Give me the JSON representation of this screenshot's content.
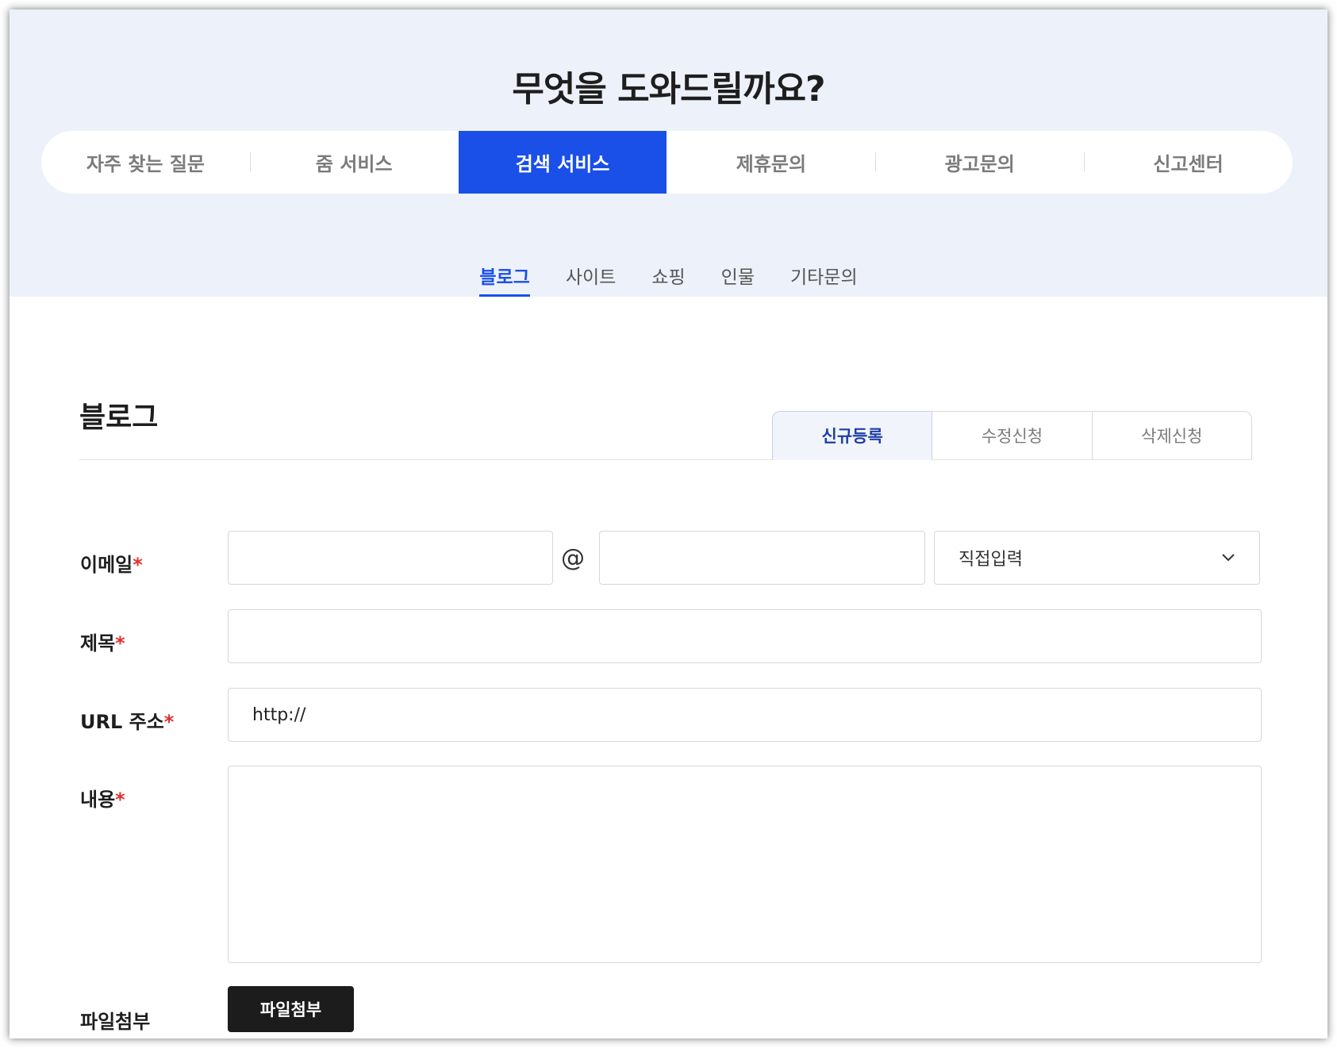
{
  "hero": {
    "title": "무엇을 도와드릴까요?"
  },
  "main_tabs": [
    {
      "label": "자주 찾는 질문",
      "active": false
    },
    {
      "label": "줌 서비스",
      "active": false
    },
    {
      "label": "검색 서비스",
      "active": true
    },
    {
      "label": "제휴문의",
      "active": false
    },
    {
      "label": "광고문의",
      "active": false
    },
    {
      "label": "신고센터",
      "active": false
    }
  ],
  "sub_tabs": [
    {
      "label": "블로그",
      "active": true
    },
    {
      "label": "사이트",
      "active": false
    },
    {
      "label": "쇼핑",
      "active": false
    },
    {
      "label": "인물",
      "active": false
    },
    {
      "label": "기타문의",
      "active": false
    }
  ],
  "section": {
    "title": "블로그"
  },
  "mode_tabs": [
    {
      "label": "신규등록",
      "active": true
    },
    {
      "label": "수정신청",
      "active": false
    },
    {
      "label": "삭제신청",
      "active": false
    }
  ],
  "form": {
    "required_mark": "*",
    "email": {
      "label": "이메일",
      "local_value": "",
      "domain_value": "",
      "at_sign": "@",
      "domain_select": "직접입력"
    },
    "subject": {
      "label": "제목",
      "value": ""
    },
    "url": {
      "label": "URL 주소",
      "value": "http://"
    },
    "content": {
      "label": "내용",
      "value": ""
    },
    "attachment": {
      "label": "파일첨부",
      "button_label": "파일첨부"
    }
  },
  "colors": {
    "hero_background": "#edf1fa",
    "accent": "#1a4fe8",
    "required": "#e0302e",
    "file_button": "#1c1c1c"
  },
  "icons": {
    "select_arrow": "chevron-down-icon"
  }
}
